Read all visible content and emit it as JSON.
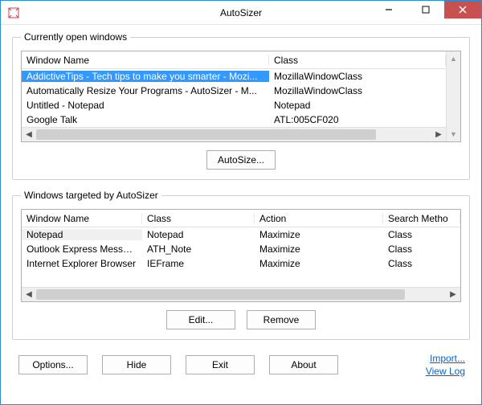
{
  "title": "AutoSizer",
  "group_open": {
    "legend": "Currently open windows",
    "columns": [
      "Window Name",
      "Class"
    ],
    "rows": [
      {
        "name": "AddictiveTips - Tech tips to make you smarter - Mozi...",
        "class": "MozillaWindowClass",
        "selected": true
      },
      {
        "name": "Automatically Resize Your Programs - AutoSizer - M...",
        "class": "MozillaWindowClass"
      },
      {
        "name": "Untitled - Notepad",
        "class": "Notepad"
      },
      {
        "name": "Google Talk",
        "class": "ATL:005CF020"
      }
    ],
    "autosize_label": "AutoSize..."
  },
  "group_target": {
    "legend": "Windows targeted by AutoSizer",
    "columns": [
      "Window Name",
      "Class",
      "Action",
      "Search Metho"
    ],
    "rows": [
      {
        "name": "Notepad",
        "class": "Notepad",
        "action": "Maximize",
        "method": "Class",
        "selected": true
      },
      {
        "name": "Outlook Express Message",
        "class": "ATH_Note",
        "action": "Maximize",
        "method": "Class"
      },
      {
        "name": "Internet Explorer Browser",
        "class": "IEFrame",
        "action": "Maximize",
        "method": "Class"
      }
    ],
    "edit_label": "Edit...",
    "remove_label": "Remove"
  },
  "bottom": {
    "options": "Options...",
    "hide": "Hide",
    "exit": "Exit",
    "about": "About",
    "import": "Import...",
    "viewlog": "View Log"
  }
}
